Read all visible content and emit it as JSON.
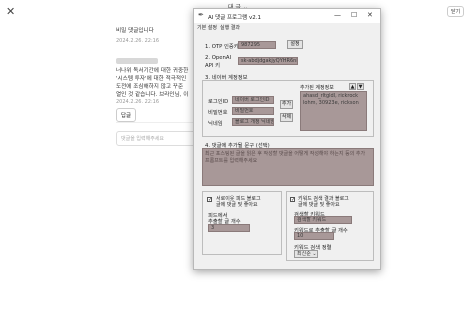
{
  "browser": {
    "close_glyph": "✕",
    "close_label": "닫기",
    "nav_center": "대 글 ⌄"
  },
  "comments": [
    {
      "text_lines": [
        "비밀 댓글입니다"
      ],
      "date": "2024.2.26. 22:16"
    },
    {
      "text_lines": [
        "너나위 독서기간에 대한 귀중한",
        "'시스템 투자'에 대한 적극적인",
        "도전에 조심해하지 않고 꾸준",
        "열인 것 같습니다. 브라인님, 이"
      ],
      "date": "2024.2.26. 22:16"
    }
  ],
  "reply_label": "답글",
  "reply_placeholder": "댓글을 입력해주세요",
  "window": {
    "title": "AI 댓글 프로그램 v2.1",
    "controls": {
      "minimize": "—",
      "maximize": "☐",
      "close": "✕"
    },
    "menu": [
      "기본 설정",
      "실행 결과"
    ],
    "otp": {
      "label": "1. OTP 인증키",
      "value": "987295",
      "button": "설정"
    },
    "openai": {
      "label_line1": "2. OpenAI",
      "label_line2": "API 키",
      "value": "sk-abdjdgakjyQYHR6nktXQ"
    },
    "naver_title": "3. 네이버 계정정보",
    "fields": [
      {
        "label": "로그인ID",
        "value": "네이버 로그인ID"
      },
      {
        "label": "비밀번호",
        "value": "비밀번호"
      },
      {
        "label": "닉네임",
        "value": "블로그 개정 닉네임"
      }
    ],
    "add_button": "추가",
    "delete_button": "삭제",
    "account_list_title": "추가된 계정정보",
    "account_list": [
      "ahasd_rltgldl, rickrock",
      "lohm, 30923e, rickson"
    ],
    "prompt_title": "4. 댓글에 추가될 문구 (선택)",
    "prompt_placeholder": "최근 포스팅된 글을 읽은 후 작성할 댓글을 어떻게 작성해야 하는지 등의 추가 프롬프트를 입력해주세요",
    "left_group": {
      "checkbox_text_1": "서로이웃 피드 블로그",
      "checkbox_text_2": "글에 댓글 및 좋아요",
      "checked": true,
      "feed_label_1": "피드에서",
      "feed_label_2": "추출할 글 개수",
      "feed_value": "3"
    },
    "right_group": {
      "checkbox_text_1": "키워드 검색 결과 블로그",
      "checkbox_text_2": "글에 댓글 및 좋아요",
      "checked": true,
      "kw_label": "검색할 키워드",
      "kw_value": "검색할 키워드",
      "kw_count_label": "키워드로 추출할 글 개수",
      "kw_count_value": "10",
      "sort_label": "키워드 검색 정렬",
      "sort_value": "최신순"
    }
  }
}
